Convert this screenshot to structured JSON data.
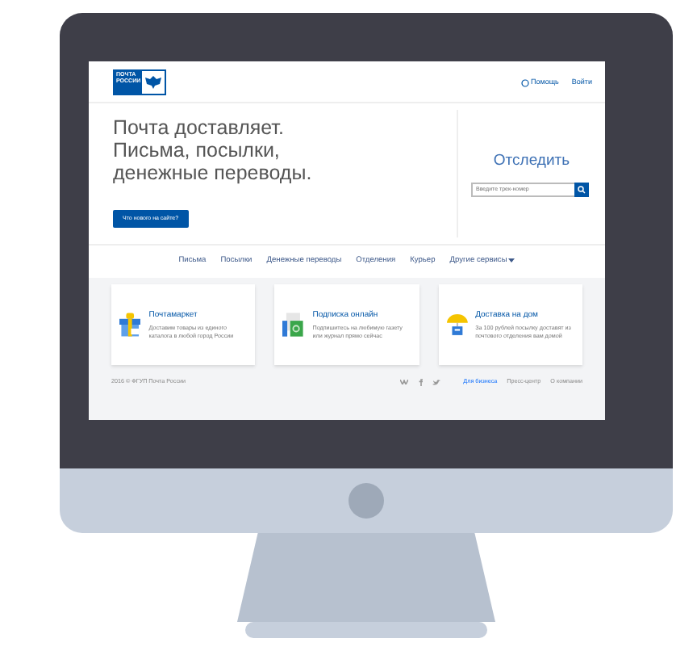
{
  "logo": {
    "text": "ПОЧТА РОССИИ"
  },
  "header_links": [
    {
      "text": "Помощь",
      "kind": "help"
    },
    {
      "text": "Войти",
      "kind": "plain"
    }
  ],
  "hero": {
    "heading": [
      "Почта доставляет.",
      "Письма, посылки,",
      "денежные переводы."
    ],
    "button": "Что нового на сайте?"
  },
  "tracking": {
    "title": "Отследить",
    "placeholder": "Введите трек-номер"
  },
  "nav": [
    {
      "text": "Письма",
      "dropdown": false
    },
    {
      "text": "Посылки",
      "dropdown": false
    },
    {
      "text": "Денежные переводы",
      "dropdown": false
    },
    {
      "text": "Отделения",
      "dropdown": false
    },
    {
      "text": "Курьер",
      "dropdown": false
    },
    {
      "text": "Другие сервисы",
      "dropdown": true
    }
  ],
  "cards": [
    {
      "kind": "gift",
      "title": "Почтамаркет",
      "text": "Доставим товары из единого каталога в любой город России"
    },
    {
      "kind": "press",
      "title": "Подписка онлайн",
      "text": "Подпишитесь на любимую газету или журнал прямо сейчас"
    },
    {
      "kind": "umbrella",
      "title": "Доставка на дом",
      "text": "За 100 рублей посылку доставят из почтового отделения вам домой"
    }
  ],
  "footer": {
    "copyright": "2016 © ФГУП Почта России",
    "links": [
      "Для бизнеса",
      "Пресс-центр",
      "О компании"
    ]
  }
}
